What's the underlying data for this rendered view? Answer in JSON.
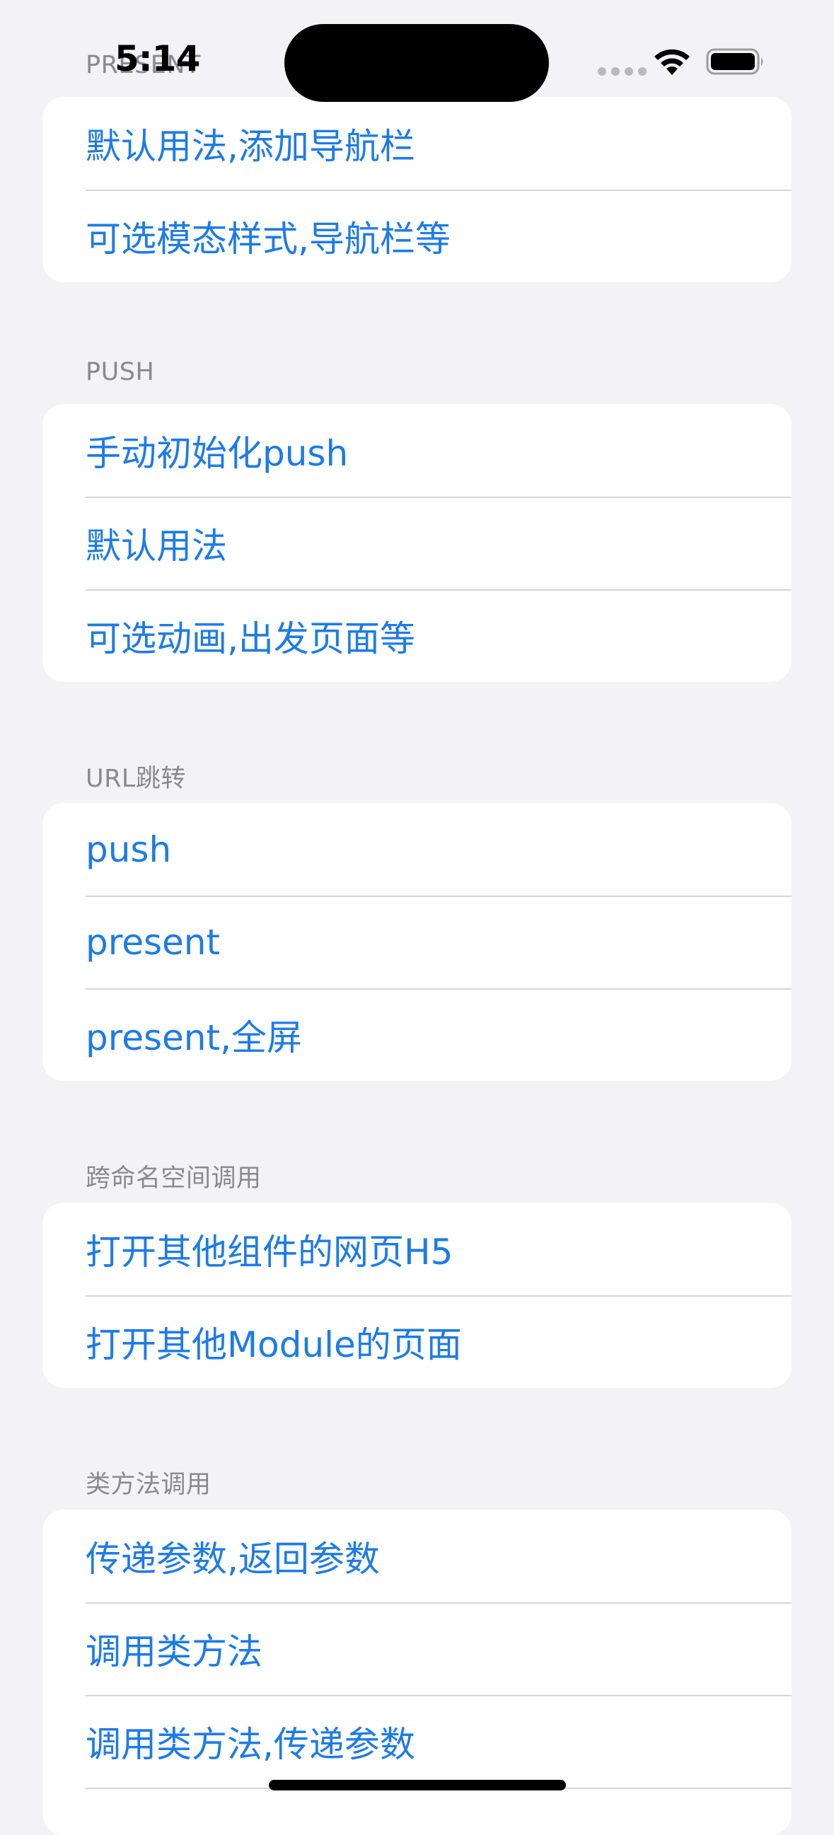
{
  "status_bar": {
    "time": "5:14"
  },
  "sections": [
    {
      "header": "PRESENT",
      "items": [
        "默认用法,添加导航栏",
        "可选模态样式,导航栏等"
      ]
    },
    {
      "header": "PUSH",
      "items": [
        "手动初始化push",
        "默认用法",
        "可选动画,出发页面等"
      ]
    },
    {
      "header": "URL跳转",
      "items": [
        "push",
        "present",
        "present,全屏"
      ]
    },
    {
      "header": "跨命名空间调用",
      "items": [
        "打开其他组件的网页H5",
        "打开其他Module的页面"
      ]
    },
    {
      "header": "类方法调用",
      "items": [
        "传递参数,返回参数",
        "调用类方法",
        "调用类方法,传递参数"
      ]
    }
  ],
  "colors": {
    "accent": "#1d7be8",
    "background": "#f2f2f7",
    "header_text": "#8a8a8e"
  }
}
